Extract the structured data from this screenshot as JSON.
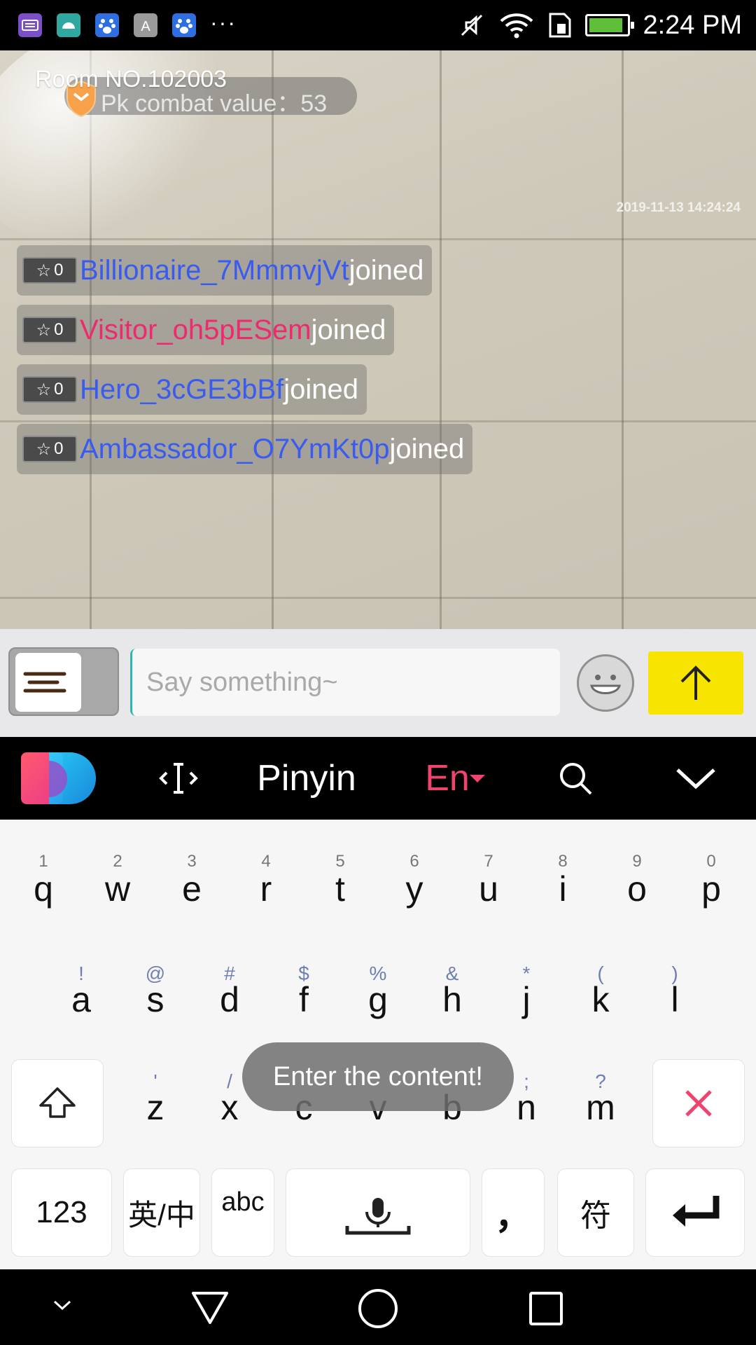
{
  "status_bar": {
    "time": "2:24 PM",
    "app_icons": [
      "keyboard-app-icon",
      "android-app-icon",
      "baidu-app-icon",
      "font-app-icon",
      "baidu-app-icon"
    ],
    "more": "···",
    "battery_level": 0.9
  },
  "stage": {
    "room_no": "Room NO.102003",
    "pk_combat": "Pk combat value：53",
    "timestamp": "2019-11-13 14:24:24",
    "messages": [
      {
        "badge": "0",
        "user": "Billionaire_7MmmvjVt",
        "action": "joined",
        "color": "#3a5bf0"
      },
      {
        "badge": "0",
        "user": "Visitor_oh5pESem",
        "action": "joined",
        "color": "#ee2a6e"
      },
      {
        "badge": "0",
        "user": "Hero_3cGE3bBf",
        "action": "joined",
        "color": "#3a5bf0"
      },
      {
        "badge": "0",
        "user": "Ambassador_O7YmKt0p",
        "action": "joined",
        "color": "#3a5bf0"
      }
    ]
  },
  "input_bar": {
    "placeholder": "Say something~",
    "send_color": "#f7e400"
  },
  "kb_toolbar": {
    "pinyin": "Pinyin",
    "en": "En"
  },
  "keyboard": {
    "row1": [
      {
        "hint": "1",
        "key": "q"
      },
      {
        "hint": "2",
        "key": "w"
      },
      {
        "hint": "3",
        "key": "e"
      },
      {
        "hint": "4",
        "key": "r"
      },
      {
        "hint": "5",
        "key": "t"
      },
      {
        "hint": "6",
        "key": "y"
      },
      {
        "hint": "7",
        "key": "u"
      },
      {
        "hint": "8",
        "key": "i"
      },
      {
        "hint": "9",
        "key": "o"
      },
      {
        "hint": "0",
        "key": "p"
      }
    ],
    "row2": [
      {
        "hint": "!",
        "key": "a"
      },
      {
        "hint": "@",
        "key": "s"
      },
      {
        "hint": "#",
        "key": "d"
      },
      {
        "hint": "$",
        "key": "f"
      },
      {
        "hint": "%",
        "key": "g"
      },
      {
        "hint": "&",
        "key": "h"
      },
      {
        "hint": "*",
        "key": "j"
      },
      {
        "hint": "(",
        "key": "k"
      },
      {
        "hint": ")",
        "key": "l"
      }
    ],
    "row3": [
      {
        "hint": "'",
        "key": "z"
      },
      {
        "hint": "/",
        "key": "x"
      },
      {
        "hint": "",
        "key": "c"
      },
      {
        "hint": "",
        "key": "v"
      },
      {
        "hint": "",
        "key": "b"
      },
      {
        "hint": ";",
        "key": "n"
      },
      {
        "hint": "?",
        "key": "m"
      }
    ],
    "num_key": "123",
    "lang_key": "英/中",
    "abc_key": "abc",
    "comma_key": "，",
    "symbol_key": "符"
  },
  "toast": "Enter the content!"
}
